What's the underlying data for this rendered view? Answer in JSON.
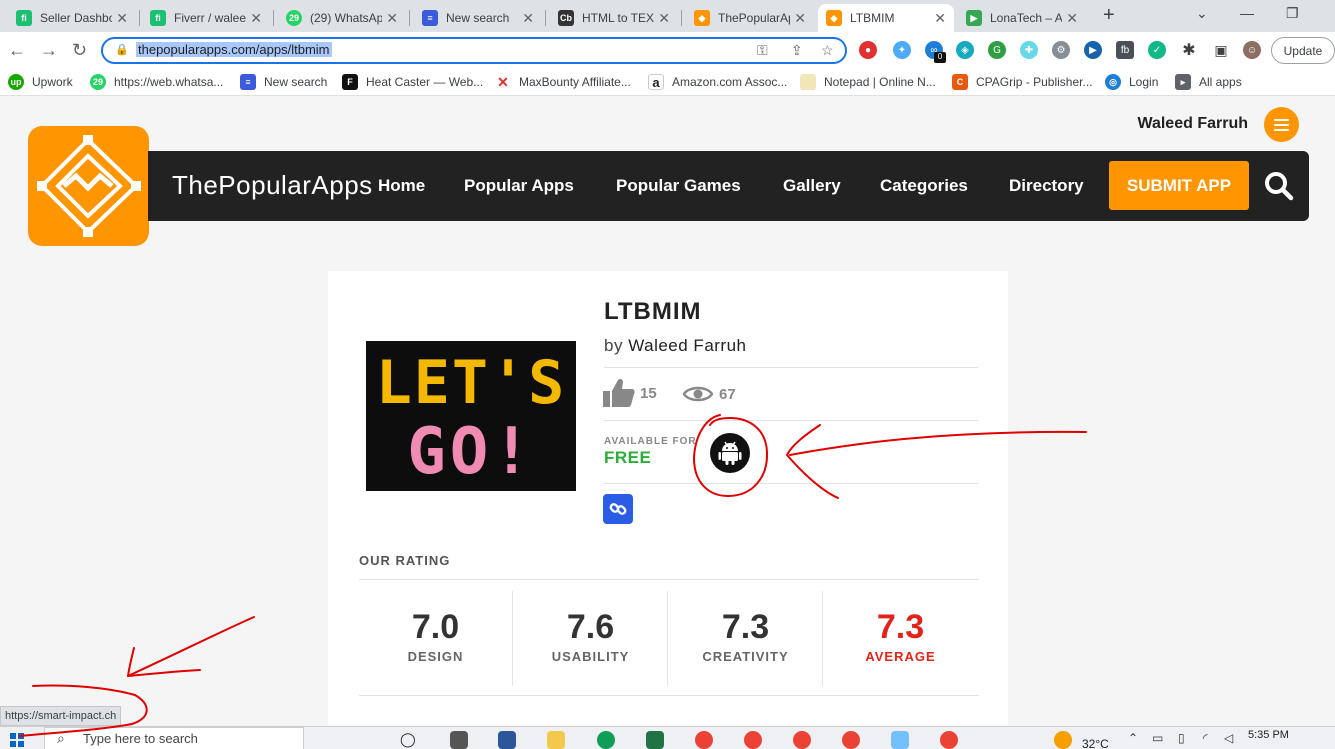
{
  "browser": {
    "tabs": [
      {
        "title": "Seller Dashbo",
        "fav": "#1dbf73",
        "glyph": "fi"
      },
      {
        "title": "Fiverr / walee",
        "fav": "#1dbf73",
        "glyph": "fi"
      },
      {
        "title": "(29) WhatsAp",
        "fav": "#25d366",
        "glyph": "29"
      },
      {
        "title": "New search",
        "fav": "#3b5bdb",
        "glyph": "≡"
      },
      {
        "title": "HTML to TEXT",
        "fav": "#333333",
        "glyph": "Cb"
      },
      {
        "title": "ThePopularAp",
        "fav": "#ff9500",
        "glyph": "◆"
      },
      {
        "title": "LTBMIM",
        "fav": "#ff9500",
        "glyph": "◆"
      },
      {
        "title": "LonaTech – Ap",
        "fav": "#34a853",
        "glyph": "▶"
      }
    ],
    "url": "thepopularapps.com/apps/ltbmim",
    "update_label": "Update",
    "extension_badge": "0",
    "bookmarks": [
      {
        "label": "Upwork",
        "color": "#14a800",
        "glyph": "up"
      },
      {
        "label": "https://web.whatsa...",
        "color": "#25d366",
        "glyph": "29"
      },
      {
        "label": "New search",
        "color": "#3b5bdb",
        "glyph": "≡"
      },
      {
        "label": "Heat Caster — Web...",
        "color": "#111111",
        "glyph": "F"
      },
      {
        "label": "MaxBounty Affiliate...",
        "color": "#e03131",
        "glyph": "✕"
      },
      {
        "label": "Amazon.com Assoc...",
        "color": "#222222",
        "glyph": "a"
      },
      {
        "label": "Notepad | Online N...",
        "color": "#f2e6b8",
        "glyph": " "
      },
      {
        "label": "CPAGrip - Publisher...",
        "color": "#e8590c",
        "glyph": "C"
      },
      {
        "label": "Login",
        "color": "#1c7ed6",
        "glyph": "◎"
      },
      {
        "label": "All apps",
        "color": "#5f6368",
        "glyph": "▸"
      }
    ]
  },
  "site": {
    "name": "ThePopularApps",
    "user": "Waleed Farruh",
    "nav": [
      "Home",
      "Popular Apps",
      "Popular Games",
      "Gallery",
      "Categories",
      "Directory"
    ],
    "submit_label": "SUBMIT APP"
  },
  "app": {
    "title": "LTBMIM",
    "by_prefix": "by",
    "author": "Waleed Farruh",
    "icon_text_top": "LET'S",
    "icon_text_bottom": "GO!",
    "likes": "15",
    "views": "67",
    "available_label": "AVAILABLE FOR",
    "price": "FREE",
    "platform": "android"
  },
  "rating": {
    "heading": "OUR RATING",
    "items": [
      {
        "value": "7.0",
        "label": "DESIGN"
      },
      {
        "value": "7.6",
        "label": "USABILITY"
      },
      {
        "value": "7.3",
        "label": "CREATIVITY"
      },
      {
        "value": "7.3",
        "label": "AVERAGE"
      }
    ]
  },
  "status_url": "https://smart-impact.ch",
  "taskbar": {
    "search_placeholder": "Type here to search",
    "temperature": "32°C",
    "time": "5:35 PM"
  },
  "colors": {
    "brand": "#ff9500",
    "nav_bg": "#222222",
    "free": "#2eac3a",
    "average": "#e2231a",
    "annotation": "#e00000"
  }
}
